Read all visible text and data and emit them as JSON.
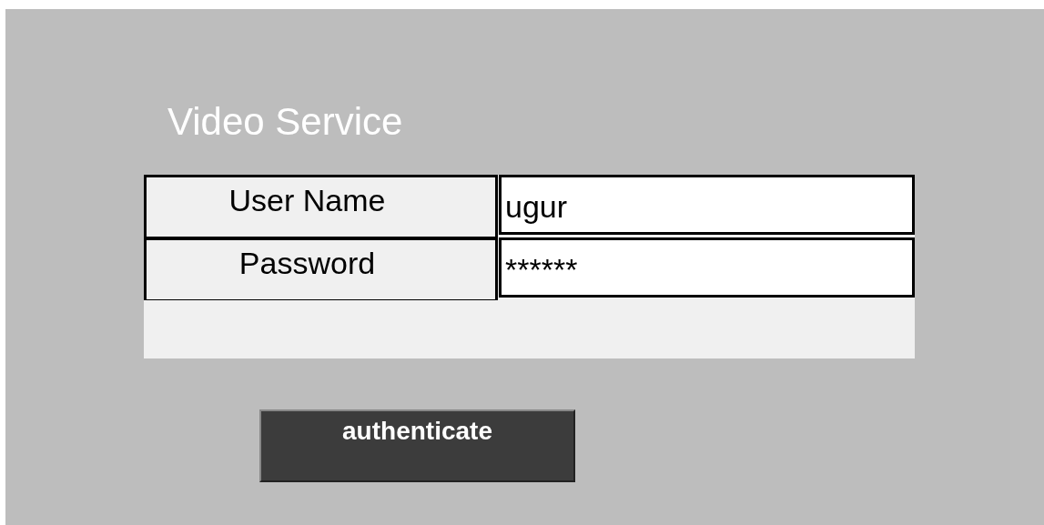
{
  "title": "Video Service",
  "fields": [
    {
      "label": "User Name",
      "value": "ugur"
    },
    {
      "label": "Password",
      "value": "******"
    }
  ],
  "button": "authenticate"
}
